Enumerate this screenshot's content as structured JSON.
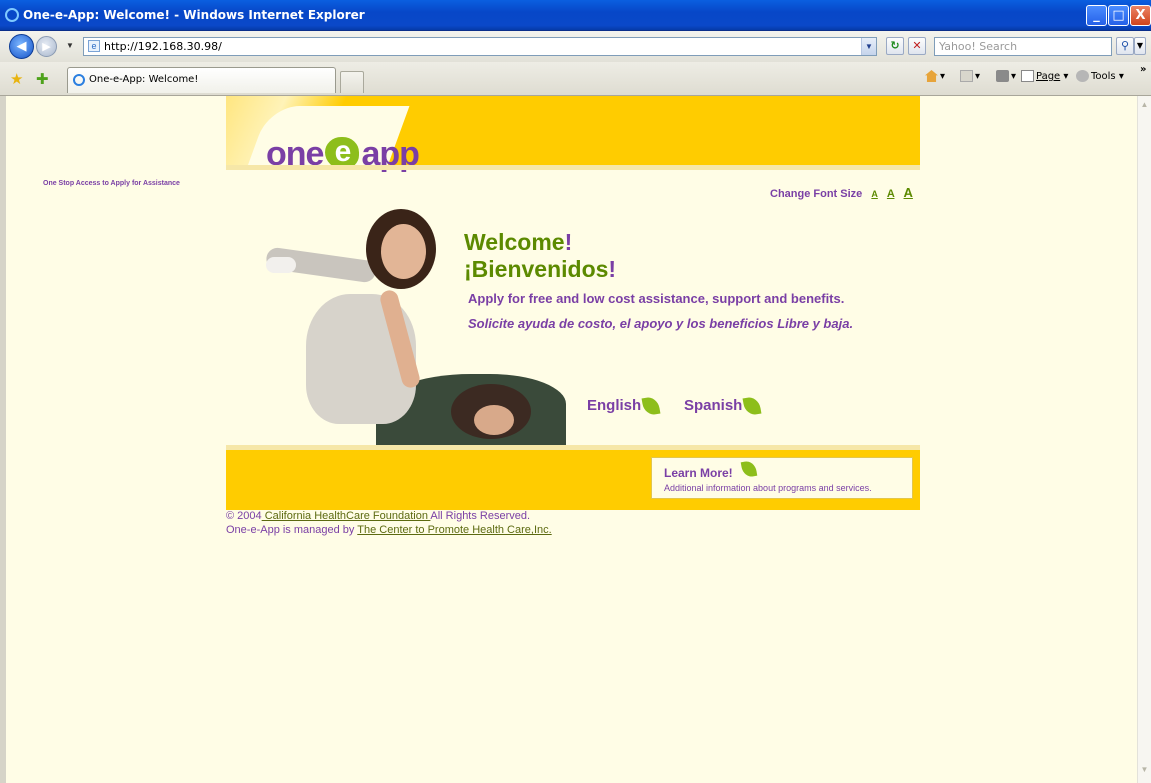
{
  "window": {
    "title": "One-e-App: Welcome! - Windows Internet Explorer",
    "buttons": {
      "minimize": "_",
      "maximize": "□",
      "close": "X"
    }
  },
  "browser": {
    "url": "http://192.168.30.98/",
    "search_placeholder": "Yahoo! Search",
    "tab_label": "One-e-App: Welcome!",
    "commands": {
      "page": "Page",
      "tools": "Tools"
    }
  },
  "site": {
    "logo": {
      "one": "one",
      "e": "e",
      "app": "app"
    },
    "tagline": "One Stop Access to Apply for Assistance",
    "font_size": {
      "label": "Change Font Size",
      "small": "A",
      "medium": "A",
      "large": "A"
    },
    "welcome": "Welcome",
    "bienvenidos": "¡Bienvenidos",
    "bang": "!",
    "apply_en": "Apply for free and low cost assistance, support and benefits.",
    "apply_es": "Solicite ayuda de costo, el apoyo y los beneficios Libre y baja.",
    "lang_english": "English",
    "lang_spanish": "Spanish",
    "learn_more": {
      "title": "Learn More!",
      "desc": "Additional information about programs and services."
    },
    "footer": {
      "line1_prefix": "© 2004",
      "line1_link": " California HealthCare Foundation ",
      "line1_suffix": "All Rights Reserved.",
      "line2_prefix": "One-e-App is managed by ",
      "line2_link": "The Center to Promote Health Care,Inc."
    }
  },
  "colors": {
    "purple": "#7a3fa5",
    "green": "#5c8a00",
    "yellow": "#ffcc00",
    "page_bg": "#fffde6"
  }
}
